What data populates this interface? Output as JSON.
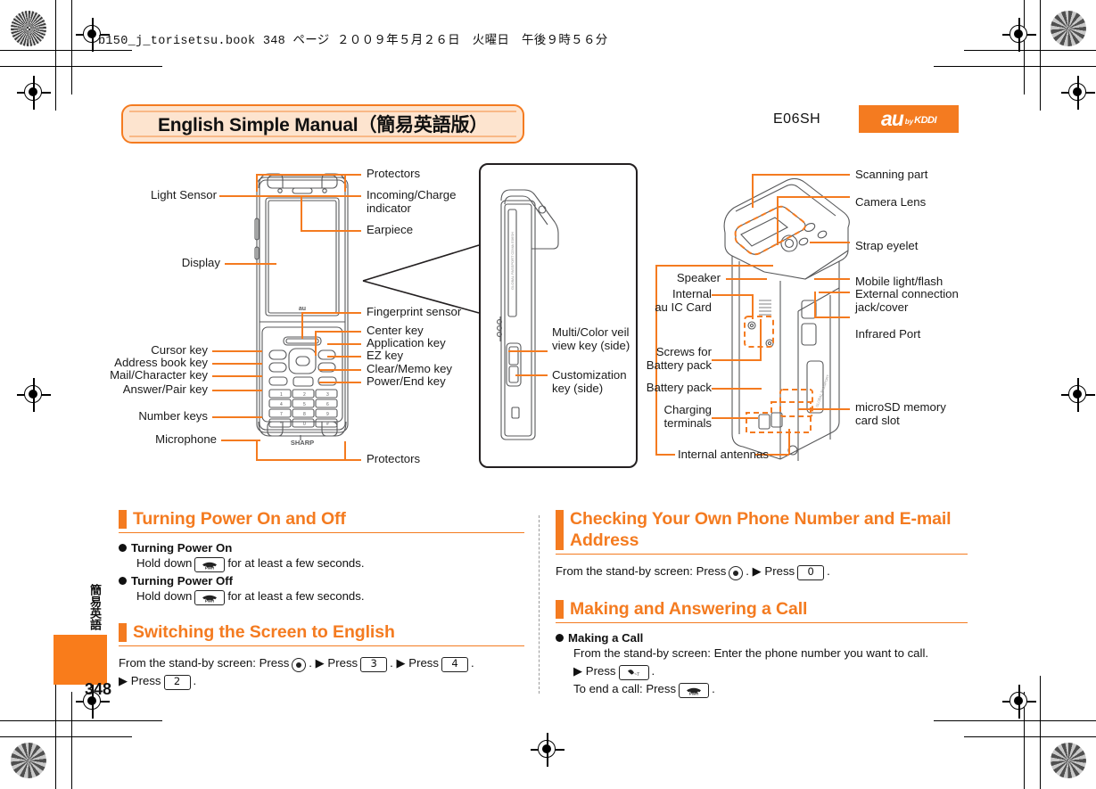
{
  "print_header": "b150_j_torisetsu.book  348 ページ  ２００９年５月２６日　火曜日　午後９時５６分",
  "banner": {
    "title": "English Simple Manual（簡易英語版）",
    "model_code": "E06SH",
    "brand": {
      "au": "au",
      "by": "by",
      "kddi": "KDDI"
    }
  },
  "colors": {
    "accent": "#F47B20",
    "banner_fill": "#FDE4CF",
    "tab_orange": "#F97C1B",
    "text": "#1a1a1a"
  },
  "diagram": {
    "front_view": {
      "left_labels": [
        "Light Sensor",
        "Display",
        "Cursor key",
        "Address book key",
        "Mail/Character key",
        "Answer/Pair key",
        "Number keys",
        "Microphone"
      ],
      "right_labels": [
        "Protectors",
        "Incoming/Charge\nindicator",
        "Earpiece",
        "Fingerprint sensor",
        "Center key",
        "Application key",
        "EZ key",
        "Clear/Memo key",
        "Power/End key",
        "Protectors"
      ],
      "handset_brand": "SHARP",
      "display_brand": "au"
    },
    "side_view": {
      "right_labels": [
        "Multi/Color veil\nview key (side)",
        "Customization\nkey (side)"
      ]
    },
    "back_view": {
      "left_labels": [
        "Speaker",
        "Internal\nau IC Card",
        "Screws for\nBattery pack",
        "Battery pack",
        "Charging\nterminals",
        "Internal antennas"
      ],
      "right_labels": [
        "Scanning part",
        "Camera Lens",
        "Strap eyelet",
        "Mobile light/flash",
        "External connection\njack/cover",
        "Infrared Port",
        "microSD memory\ncard slot"
      ]
    }
  },
  "sections": {
    "power": {
      "heading": "Turning Power On and Off",
      "on_label": "Turning Power On",
      "on_text_pre": "Hold down",
      "on_text_post": "for at least a few seconds.",
      "on_key": "PWR",
      "off_label": "Turning Power Off",
      "off_text_pre": "Hold down",
      "off_text_post": "for at least a few seconds.",
      "off_key": "PWR"
    },
    "english": {
      "heading": "Switching the Screen to English",
      "line1_pre": "From the stand-by screen: Press",
      "line1_mid1": ". ▶ Press",
      "key1": "3",
      "line1_mid2": ". ▶ Press",
      "key2": "4",
      "line1_end": ".",
      "line2_pre": "▶ Press",
      "key3": "2",
      "line2_end": "."
    },
    "phone_number": {
      "heading": "Checking Your Own Phone Number and E-mail Address",
      "line1_pre": "From the stand-by screen: Press",
      "line1_mid": ". ▶ Press",
      "key1": "0",
      "line1_end": "."
    },
    "call": {
      "heading": "Making and Answering a Call",
      "making_label": "Making a Call",
      "line1": "From the stand-by screen: Enter the phone number you want to call.",
      "line2_pre": "▶ Press",
      "send_key": "SEND",
      "line2_end": ".",
      "line3_pre": "To end a call: Press",
      "end_key": "PWR",
      "line3_end": "."
    }
  },
  "footer": {
    "side_tab_text": "簡易英語",
    "page_number": "348"
  }
}
